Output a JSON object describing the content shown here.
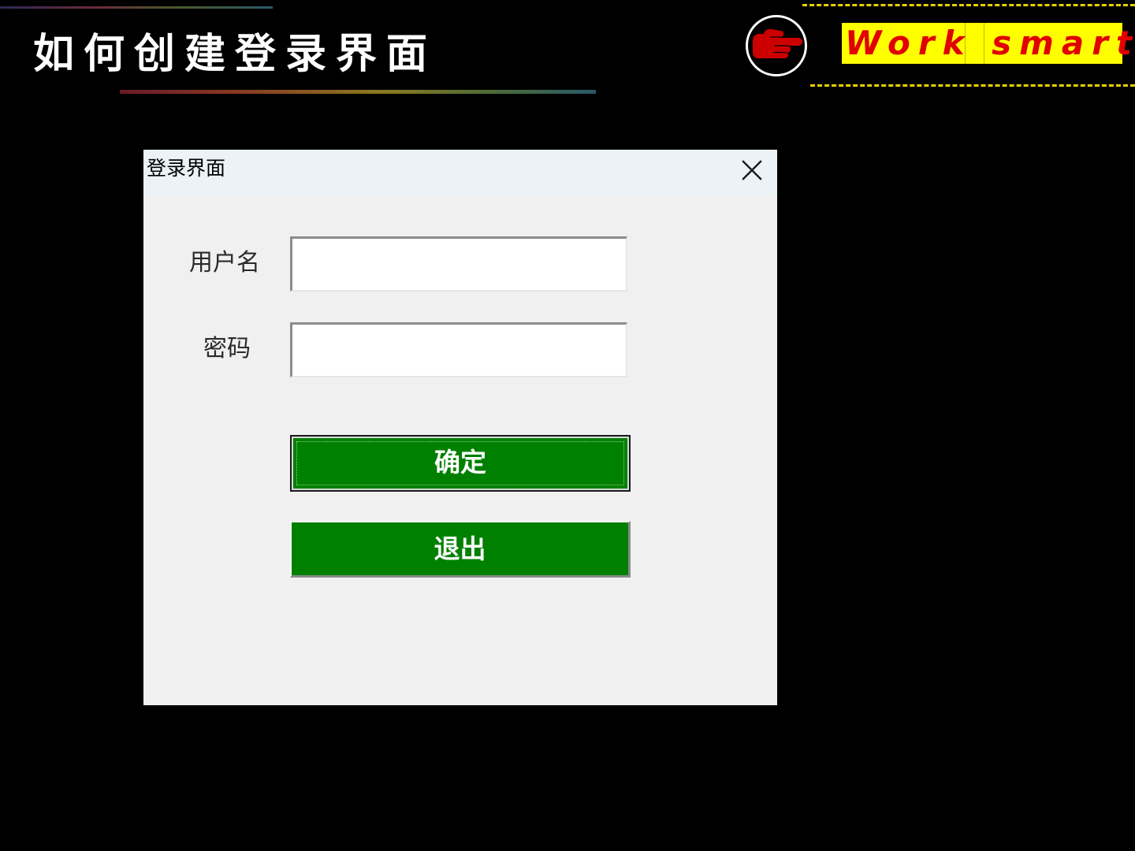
{
  "slide": {
    "title": "如何创建登录界面",
    "slogan": "Work smart",
    "hand_icon": "pointing-hand-icon",
    "colors": {
      "background": "#000000",
      "slogan_bg": "#ffff00",
      "slogan_text": "#e00000",
      "hand": "#cc0000"
    }
  },
  "dialog": {
    "title": "登录界面",
    "close_icon": "close-icon",
    "username_label": "用户名",
    "username_value": "",
    "password_label": "密码",
    "password_value": "",
    "ok_label": "确定",
    "exit_label": "退出",
    "colors": {
      "button_bg": "#008000",
      "button_text": "#ffffff",
      "window_bg": "#f0f0f0",
      "titlebar_bg": "#ebf3f6"
    }
  }
}
